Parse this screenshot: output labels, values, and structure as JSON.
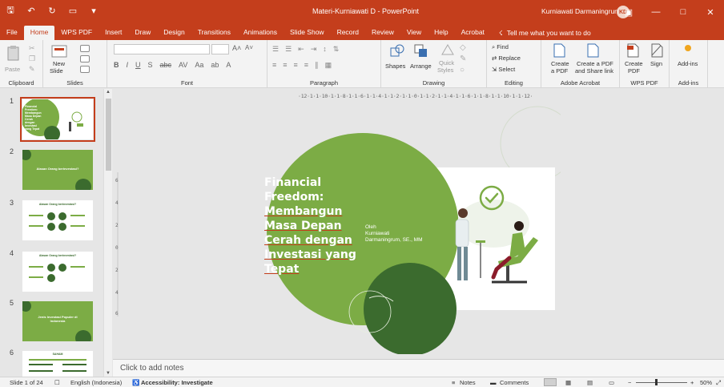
{
  "window": {
    "title": "Materi-Kurniawati D  -  PowerPoint",
    "user": "Kurniawati Darmaningrum",
    "avatar_initials": "KD"
  },
  "tabs": [
    "File",
    "Home",
    "WPS PDF",
    "Insert",
    "Draw",
    "Design",
    "Transitions",
    "Animations",
    "Slide Show",
    "Record",
    "Review",
    "View",
    "Help",
    "Acrobat"
  ],
  "active_tab": "Home",
  "tell_me": "Tell me what you want to do",
  "ribbon": {
    "clipboard": {
      "label": "Clipboard",
      "paste": "Paste"
    },
    "slides": {
      "label": "Slides",
      "new_slide_1": "New",
      "new_slide_2": "Slide"
    },
    "font": {
      "label": "Font"
    },
    "paragraph": {
      "label": "Paragraph"
    },
    "drawing": {
      "label": "Drawing",
      "shapes": "Shapes",
      "arrange": "Arrange",
      "quick_styles_1": "Quick",
      "quick_styles_2": "Styles"
    },
    "editing": {
      "label": "Editing",
      "find": "Find",
      "replace": "Replace",
      "select": "Select"
    },
    "adobe": {
      "label": "Adobe Acrobat",
      "create_pdf_1": "Create",
      "create_pdf_2": "a PDF",
      "create_share_1": "Create a PDF",
      "create_share_2": "and Share link"
    },
    "wps": {
      "label": "WPS PDF",
      "create_pdf_1": "Create",
      "create_pdf_2": "PDF",
      "sign": "Sign"
    },
    "addins": {
      "label": "Add-ins",
      "addins": "Add-ins"
    }
  },
  "thumbnails": [
    {
      "num": "1",
      "text": "Financial Freedom: Membangun Masa Depan Cerah dengan Investasi yang Tepat"
    },
    {
      "num": "2",
      "text": "Alasan Orang berinvestasi?"
    },
    {
      "num": "3",
      "text": "Alasan Orang berinvestasi?"
    },
    {
      "num": "4",
      "text": "Alasan Orang berinvestasi?"
    },
    {
      "num": "5",
      "text": "Jenis Investasi Populer di Indonesia"
    },
    {
      "num": "6",
      "text": "SAHAM"
    }
  ],
  "ruler_text": "·12·1·1·10·1·1·8·1·1·6·1·1·4·1·1·2·1·1·0·1·1·2·1·1·4·1·1·6·1·1·8·1·1·10·1·1·12·",
  "slide": {
    "title": "Financial Freedom: Membangun Masa Depan Cerah dengan Investasi yang Tepat",
    "title_lines": [
      "Financial",
      "Freedom:",
      "Membangun",
      "Masa Depan",
      "Cerah dengan",
      "Investasi yang",
      "Tepat"
    ],
    "author_lines": [
      "Oleh",
      "Kurniawati",
      "Darmaningrum, SE., MM"
    ]
  },
  "notes_placeholder": "Click to add notes",
  "status": {
    "slide_count": "Slide 1 of 24",
    "language": "English (Indonesia)",
    "accessibility": "Accessibility: Investigate",
    "notes": "Notes",
    "comments": "Comments",
    "zoom": "50%"
  },
  "colors": {
    "accent": "#c43e1c",
    "green_light": "#7cac45",
    "green_dark": "#3b6b2e"
  }
}
